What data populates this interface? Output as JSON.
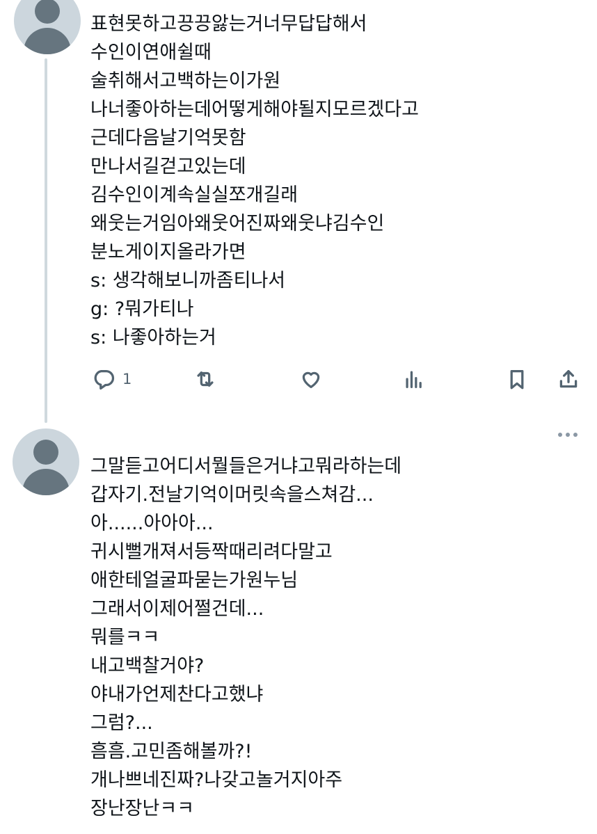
{
  "tweets": [
    {
      "lines": [
        "표현못하고끙끙앓는거너무답답해서",
        "수인이연애쉴때",
        "술취해서고백하는이가원",
        "나너좋아하는데어떻게해야될지모르겠다고",
        "근데다음날기억못함",
        "만나서길걷고있는데",
        "김수인이계속실실쪼개길래",
        "왜웃는거임아왜웃어진짜왜웃냐김수인",
        "분노게이지올라가면",
        "s: 생각해보니까좀티나서",
        "g: ?뭐가티나",
        "s: 나좋아하는거"
      ],
      "actions": {
        "reply_icon": "reply-icon",
        "reply_count": "1",
        "retweet_icon": "retweet-icon",
        "like_icon": "heart-icon",
        "views_icon": "views-icon",
        "bookmark_icon": "bookmark-icon",
        "share_icon": "share-icon"
      }
    },
    {
      "lines": [
        "그말듣고어디서뭘들은거냐고뭐라하는데",
        "갑자기.전날기억이머릿속을스쳐감...",
        "아......아아아...",
        "귀시뻘개져서등짝때리려다말고",
        "애한테얼굴파묻는가원누님",
        "그래서이제어쩔건데...",
        "뭐를ㅋㅋ",
        "내고백찰거야?",
        "야내가언제찬다고했냐",
        "그럼?...",
        "흠흠.고민좀해볼까?!",
        "개나쁘네진짜?나갖고놀거지아주",
        "장난장난ㅋㅋ"
      ],
      "more_icon": "more-icon"
    }
  ]
}
